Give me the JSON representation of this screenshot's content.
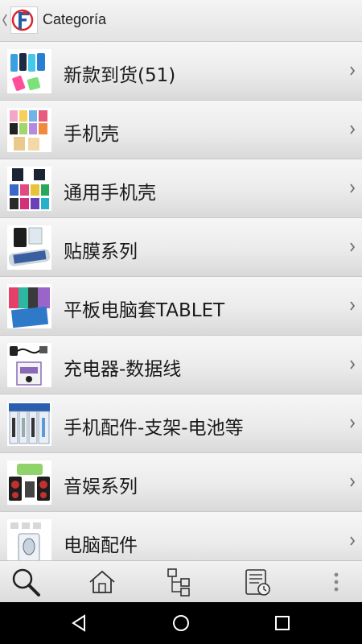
{
  "header": {
    "title": "Categoría",
    "icons": [
      "back-icon",
      "app-logo"
    ]
  },
  "categories": [
    {
      "label": "新款到货(51)",
      "thumb": "phone-cases-assorted"
    },
    {
      "label": "手机壳",
      "thumb": "flip-cases"
    },
    {
      "label": "通用手机壳",
      "thumb": "universal-cases"
    },
    {
      "label": "贴膜系列",
      "thumb": "screen-protector"
    },
    {
      "label": "平板电脑套TABLET",
      "thumb": "tablet-cases"
    },
    {
      "label": "充电器-数据线",
      "thumb": "chargers-cables"
    },
    {
      "label": "手机配件-支架-电池等",
      "thumb": "accessories-packs"
    },
    {
      "label": "音娱系列",
      "thumb": "speakers"
    },
    {
      "label": "电脑配件",
      "thumb": "computer-mouse"
    }
  ],
  "bottom_nav": {
    "icons": [
      "search-icon",
      "home-icon",
      "category-tree-icon",
      "history-list-icon",
      "more-icon"
    ]
  },
  "system_nav": {
    "icons": [
      "back-triangle-icon",
      "home-circle-icon",
      "recents-square-icon"
    ]
  },
  "colors": {
    "logo_red": "#d8262e",
    "logo_blue": "#1f5fa8",
    "navbar": "#000000"
  }
}
